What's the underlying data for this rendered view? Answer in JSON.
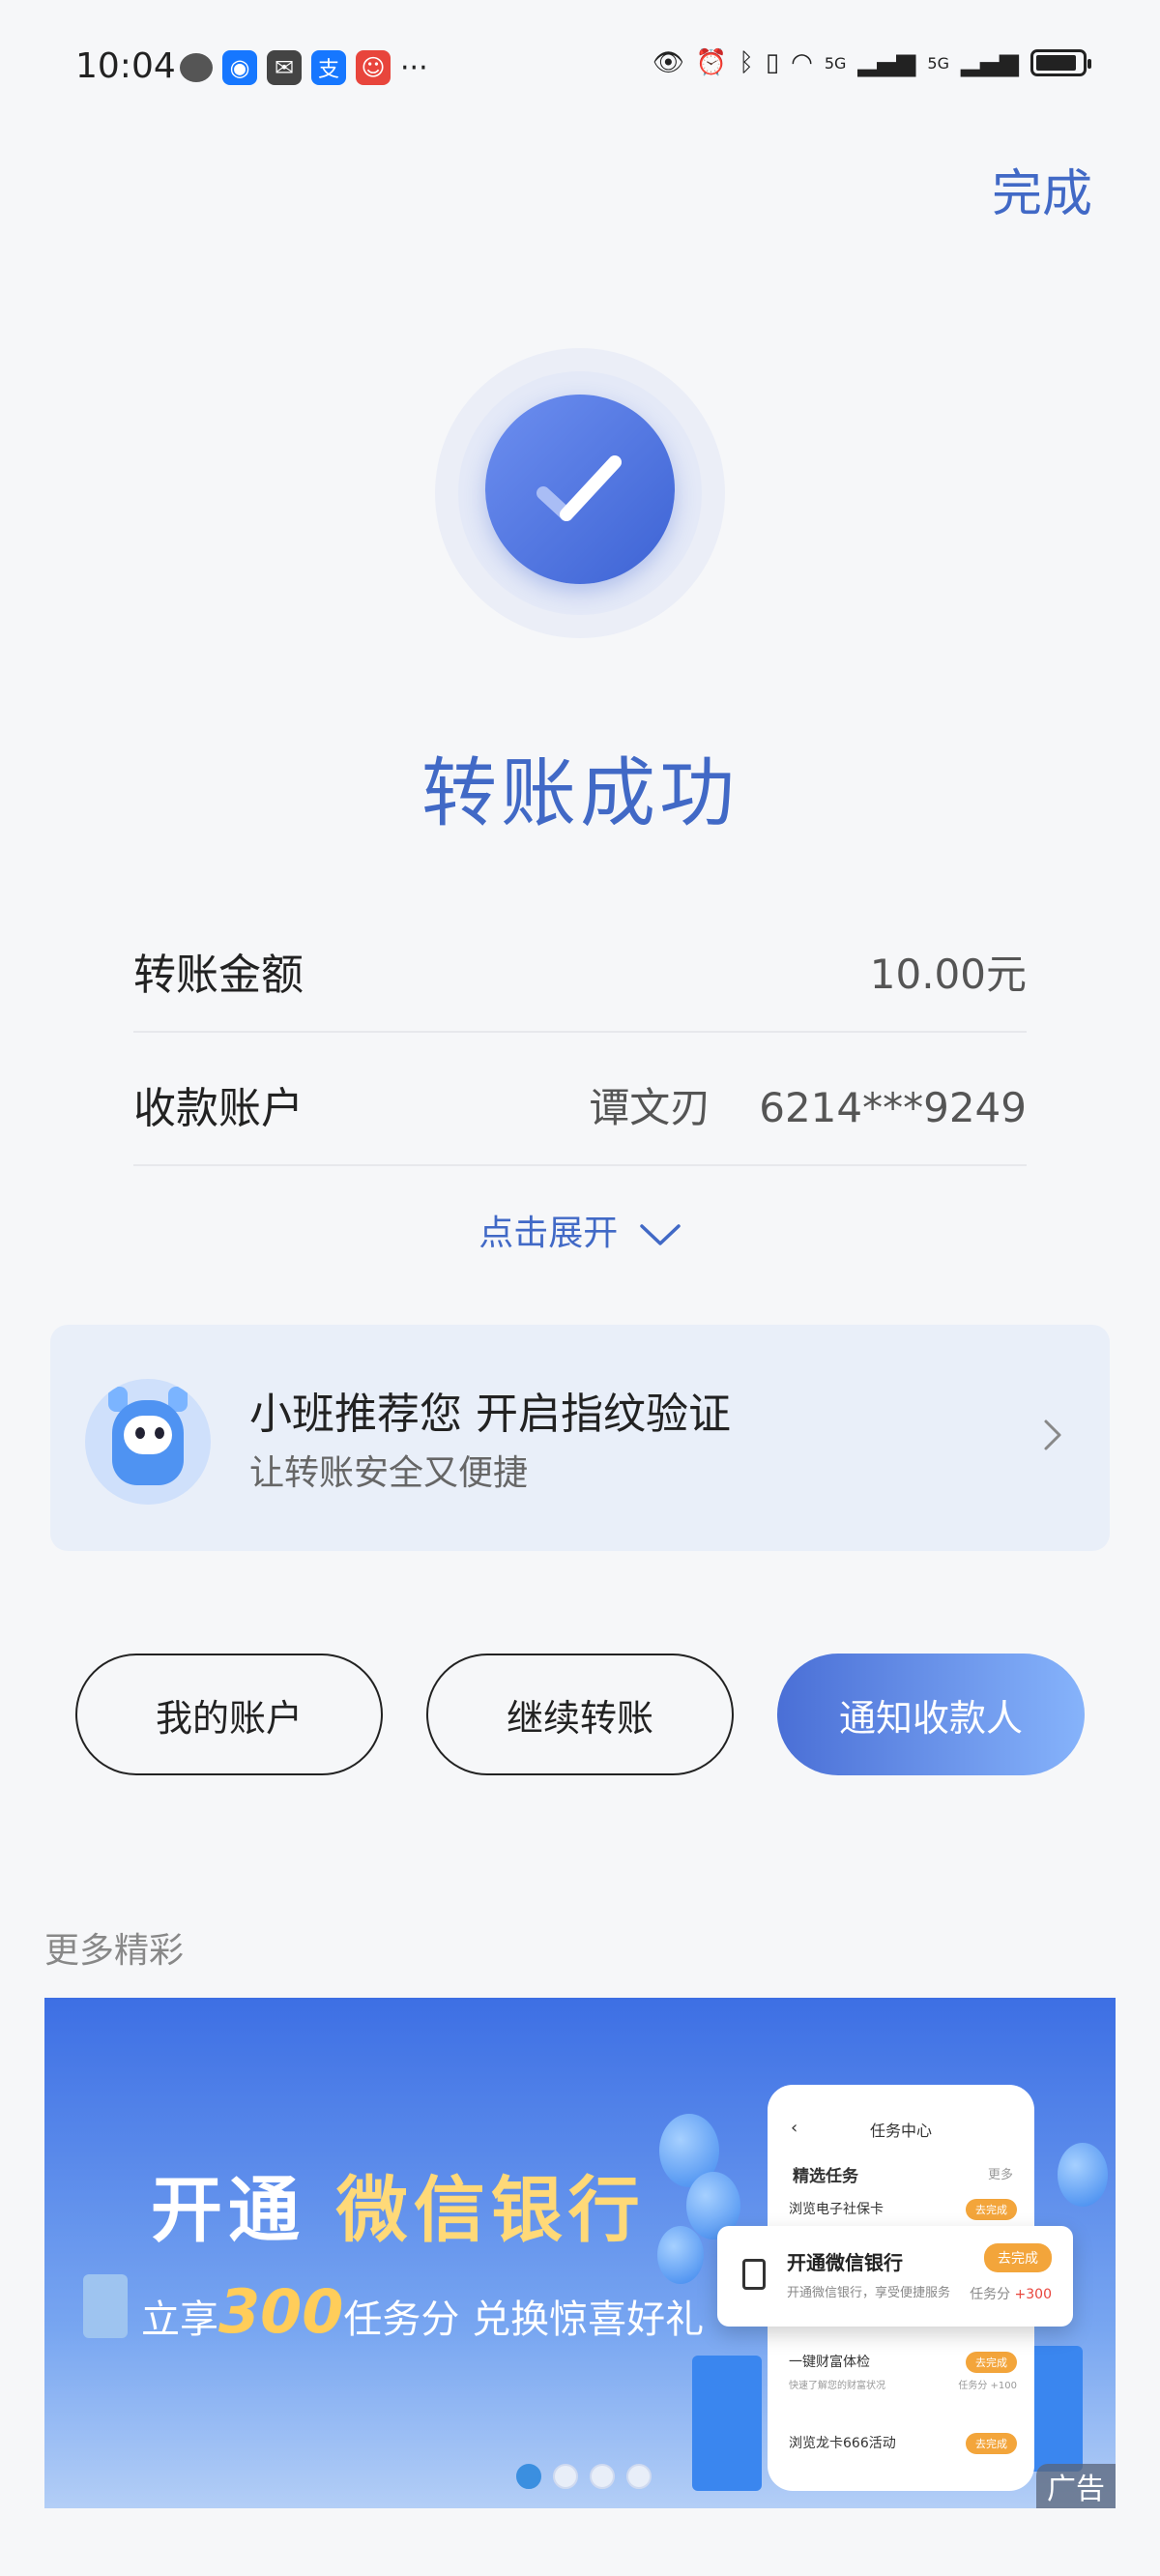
{
  "status_bar": {
    "time": "10:04",
    "more": "···",
    "network1": "5G",
    "network2": "5G",
    "app_icons": [
      "wechat-icon",
      "qq-icon",
      "mail-icon",
      "alipay-icon",
      "app-icon"
    ]
  },
  "header": {
    "done_label": "完成"
  },
  "result": {
    "title": "转账成功"
  },
  "details": {
    "amount_label": "转账金额",
    "amount_value": "10.00元",
    "account_label": "收款账户",
    "account_name": "谭文刃",
    "account_number": "6214***9249",
    "expand_label": "点击展开"
  },
  "promo_card": {
    "title": "小班推荐您 开启指纹验证",
    "subtitle": "让转账安全又便捷"
  },
  "actions": {
    "my_account": "我的账户",
    "continue_transfer": "继续转账",
    "notify_payee": "通知收款人"
  },
  "more_section": {
    "title": "更多精彩"
  },
  "banner": {
    "headline_1": "开通",
    "headline_2": "微信银行",
    "sub_prefix": "立享",
    "sub_number": "300",
    "sub_suffix": "任务分 兑换惊喜好礼",
    "phone": {
      "title": "任务中心",
      "section": "精选任务",
      "more": "更多",
      "tasks": [
        {
          "name": "浏览电子社保卡",
          "action": "去完成"
        },
        {
          "name": "一键财富体检",
          "desc": "快速了解您的财富状况",
          "action": "去完成",
          "points": "任务分 +100"
        },
        {
          "name": "浏览龙卡666活动",
          "action": "去完成"
        }
      ]
    },
    "popup": {
      "title": "开通微信银行",
      "desc": "开通微信银行，享受便捷服务",
      "action": "去完成",
      "points_label": "任务分",
      "points_value": "+300"
    },
    "ad_label": "广告",
    "active_slide": 1,
    "slide_count": 4
  },
  "colors": {
    "accent": "#4169c6",
    "background": "#f6f7f9",
    "card_bg": "#e9eff9"
  }
}
